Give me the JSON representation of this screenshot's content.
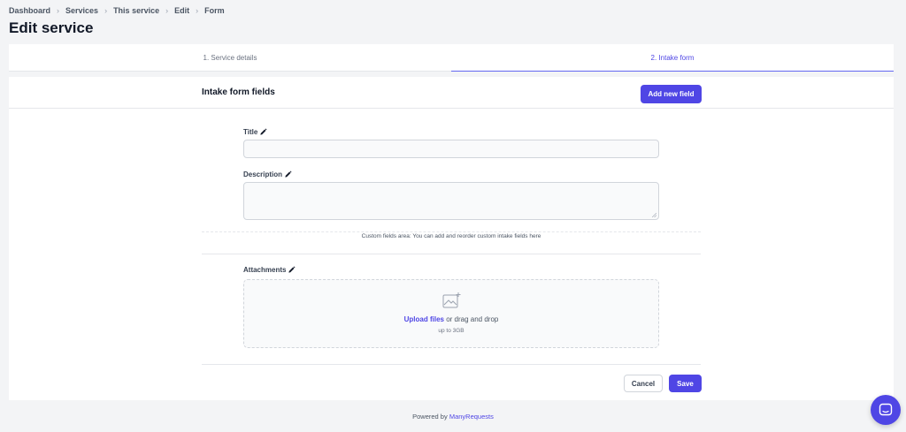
{
  "breadcrumb": [
    "Dashboard",
    "Services",
    "This service",
    "Edit",
    "Form"
  ],
  "page_title": "Edit service",
  "tabs": [
    {
      "label": "1. Service details",
      "active": false
    },
    {
      "label": "2. Intake form",
      "active": true
    }
  ],
  "section": {
    "title": "Intake form fields",
    "add_button": "Add new field"
  },
  "fields": {
    "title": {
      "label": "Title",
      "value": ""
    },
    "description": {
      "label": "Description",
      "value": ""
    },
    "attachments": {
      "label": "Attachments"
    }
  },
  "custom_note": "Custom fields area: You can add and reorder custom intake fields here",
  "upload": {
    "link": "Upload files",
    "text": " or drag and drop",
    "limit": "up to 3GB"
  },
  "actions": {
    "cancel": "Cancel",
    "save": "Save"
  },
  "footer": {
    "prefix": "Powered by ",
    "brand": "ManyRequests"
  },
  "colors": {
    "accent": "#4f46e5",
    "background": "#f3f4f6"
  },
  "icons": {
    "pencil": "pencil-icon",
    "image_upload": "image-upload-icon",
    "chat": "chat-icon",
    "breadcrumb_separator": "chevron-right-icon"
  }
}
